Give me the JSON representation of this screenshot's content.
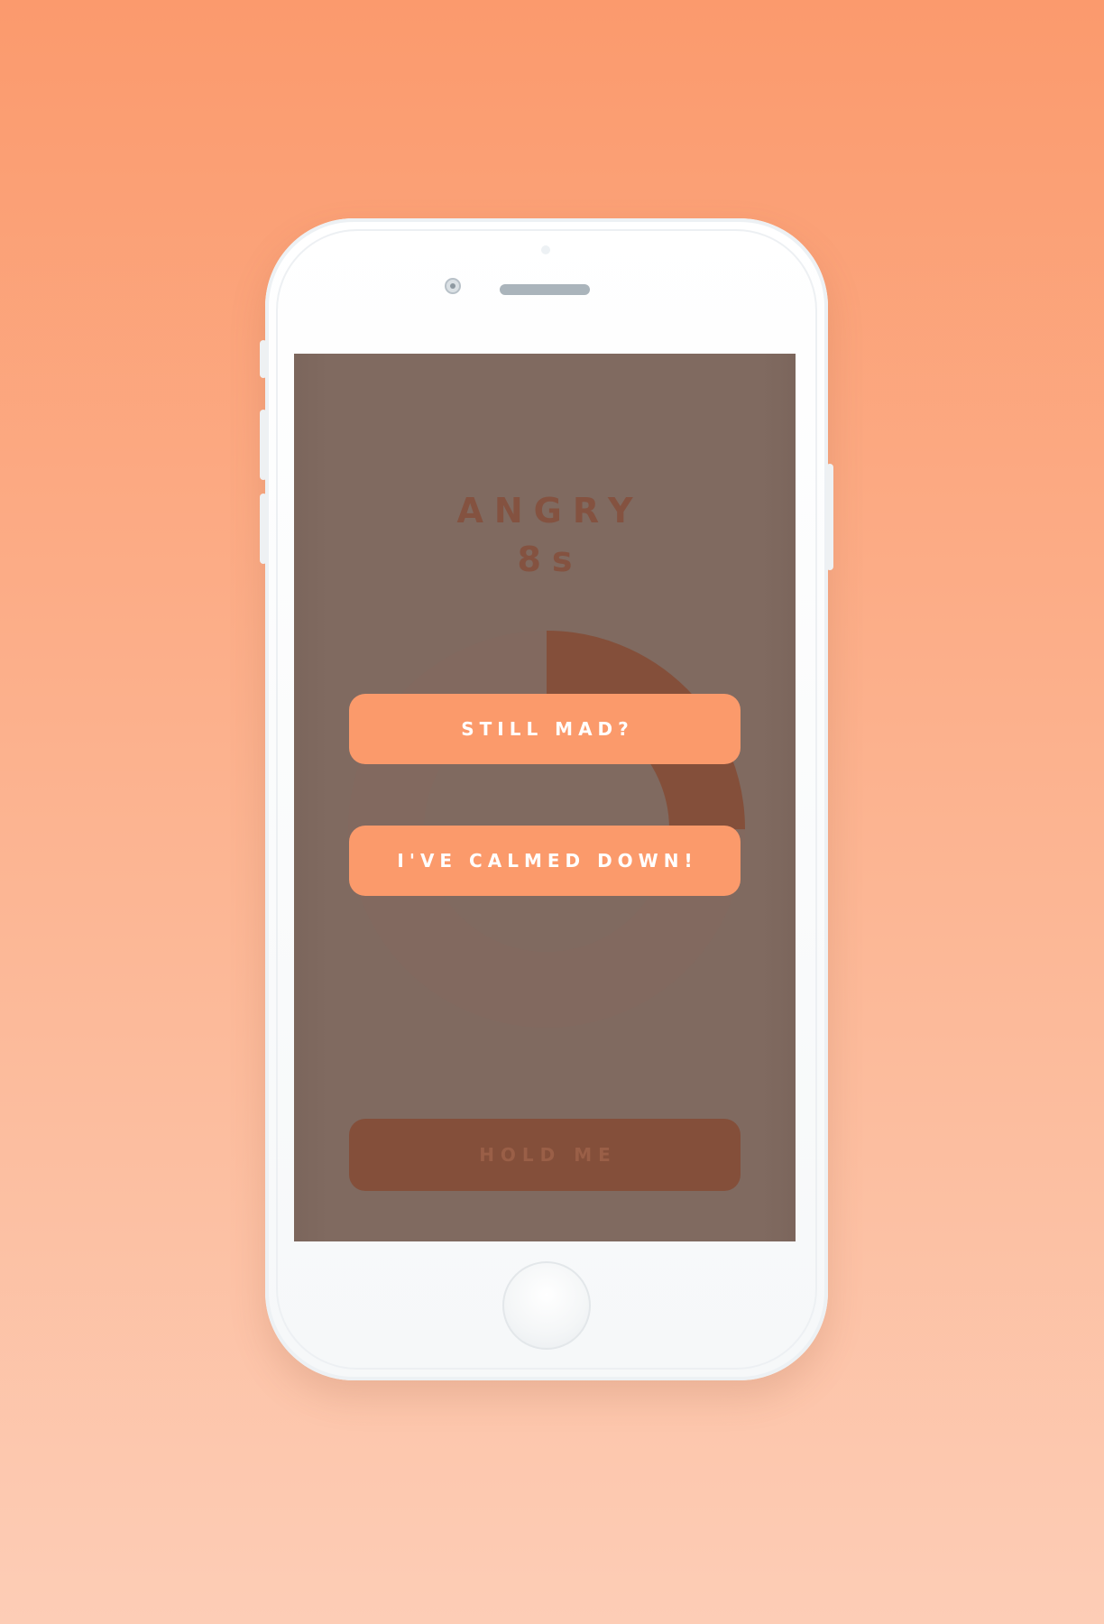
{
  "screen": {
    "title": "ANGRY",
    "timer": "8s"
  },
  "progress": {
    "fraction": 0.25
  },
  "buttons": {
    "still_mad": "STILL MAD?",
    "calmed_down": "I'VE CALMED DOWN!",
    "hold_me": "HOLD ME"
  },
  "colors": {
    "background_top": "#fb9a6d",
    "background_bottom": "#fdcdb6",
    "screen_overlay": "#806a60",
    "progress_track": "#82695f",
    "progress_fill": "#844f3a",
    "accent": "#fb9a6b",
    "hold_button": "#844f3a"
  },
  "icons": {
    "camera": "camera-icon",
    "speaker": "speaker-icon",
    "home": "home-button-icon"
  }
}
